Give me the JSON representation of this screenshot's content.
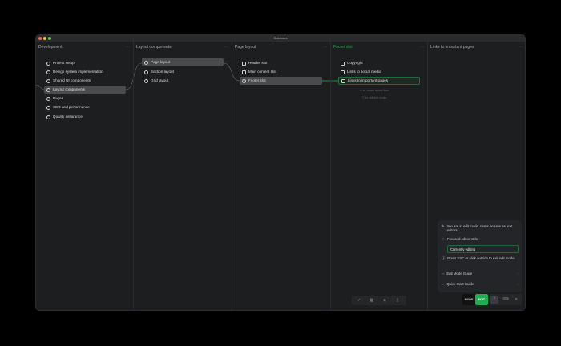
{
  "window": {
    "title": "Colonnes"
  },
  "columns": [
    {
      "title": "Development",
      "items": [
        "Project setup",
        "Design system implementation",
        "Shared UI components",
        "Layout components",
        "Pages",
        "SEO and performance",
        "Quality assurance"
      ],
      "selected": 3
    },
    {
      "title": "Layout components",
      "items": [
        "Page layout",
        "Section layout",
        "Grid layout"
      ],
      "selected": 0
    },
    {
      "title": "Page layout",
      "items": [
        "Header slot",
        "Main content slot",
        "Footer slot"
      ],
      "selected": 2
    },
    {
      "title": "Footer slot",
      "items": [
        "Copyright",
        "Links to social media",
        "Links to important pages"
      ],
      "editing": 2
    },
    {
      "title": "Links to important pages",
      "items": []
    }
  ],
  "hints": {
    "create": "to create a new item",
    "exit": "to exit edit mode",
    "create_key": "↵",
    "exit_key": "⎋"
  },
  "panel": {
    "edit_info": "You are in edit mode. Items behave as text editors.",
    "focused_label": "Focused editor style:",
    "focused_value": "Currently editing",
    "esc_info": "Press ESC or click outside to exit edit mode.",
    "guide1": "Edit Mode Guide",
    "guide2": "Quick Start Guide"
  },
  "toolbar": {
    "mode": "MODE",
    "edit": "EDIT",
    "more": "···"
  },
  "colors": {
    "accent": "#1fae4e",
    "background": "#1d1e20",
    "selected": "#4a4b4e"
  }
}
